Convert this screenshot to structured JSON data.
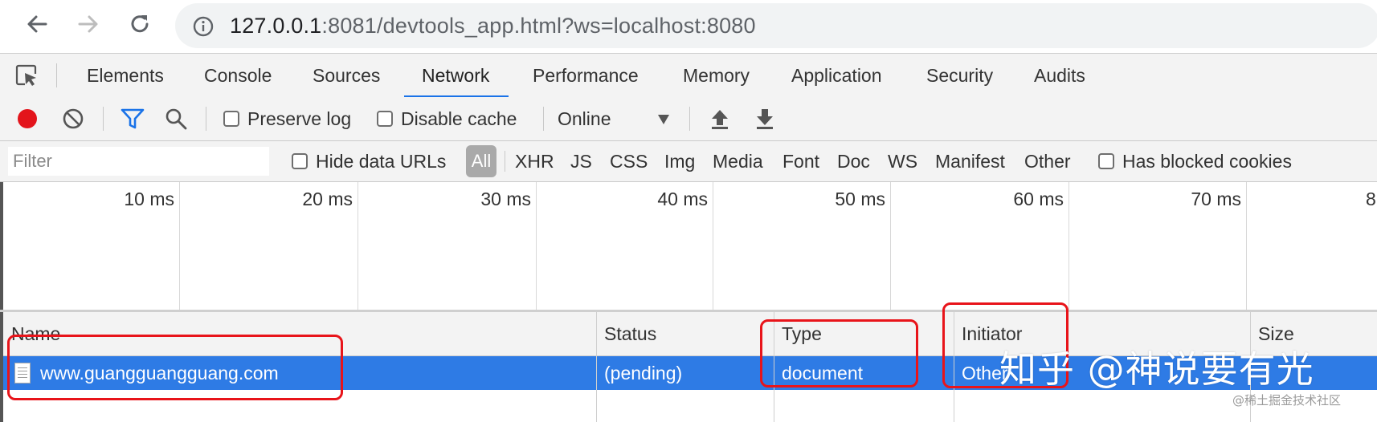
{
  "browser": {
    "url_host": "127.0.0.1",
    "url_rest": ":8081/devtools_app.html?ws=localhost:8080"
  },
  "devtools": {
    "tabs": [
      "Elements",
      "Console",
      "Sources",
      "Network",
      "Performance",
      "Memory",
      "Application",
      "Security",
      "Audits"
    ],
    "active_tab": "Network"
  },
  "toolbar": {
    "preserve_log": "Preserve log",
    "disable_cache": "Disable cache",
    "throttling": "Online"
  },
  "filter": {
    "placeholder": "Filter",
    "hide_data_urls": "Hide data URLs",
    "types": [
      "All",
      "XHR",
      "JS",
      "CSS",
      "Img",
      "Media",
      "Font",
      "Doc",
      "WS",
      "Manifest",
      "Other"
    ],
    "has_blocked_cookies": "Has blocked cookies"
  },
  "timeline": {
    "ticks": [
      "10 ms",
      "20 ms",
      "30 ms",
      "40 ms",
      "50 ms",
      "60 ms",
      "70 ms",
      "8"
    ]
  },
  "table": {
    "columns": [
      "Name",
      "Status",
      "Type",
      "Initiator",
      "Size"
    ],
    "rows": [
      {
        "name": "www.guangguangguang.com",
        "status": "(pending)",
        "type": "document",
        "initiator": "Other"
      }
    ]
  },
  "watermark": {
    "main": "知乎 @神说要有光",
    "sub": "@稀土掘金技术社区"
  },
  "colors": {
    "accent": "#1a73e8",
    "selected_row": "#2e7be5",
    "record": "#e3141b",
    "annotation": "#e8141a"
  }
}
